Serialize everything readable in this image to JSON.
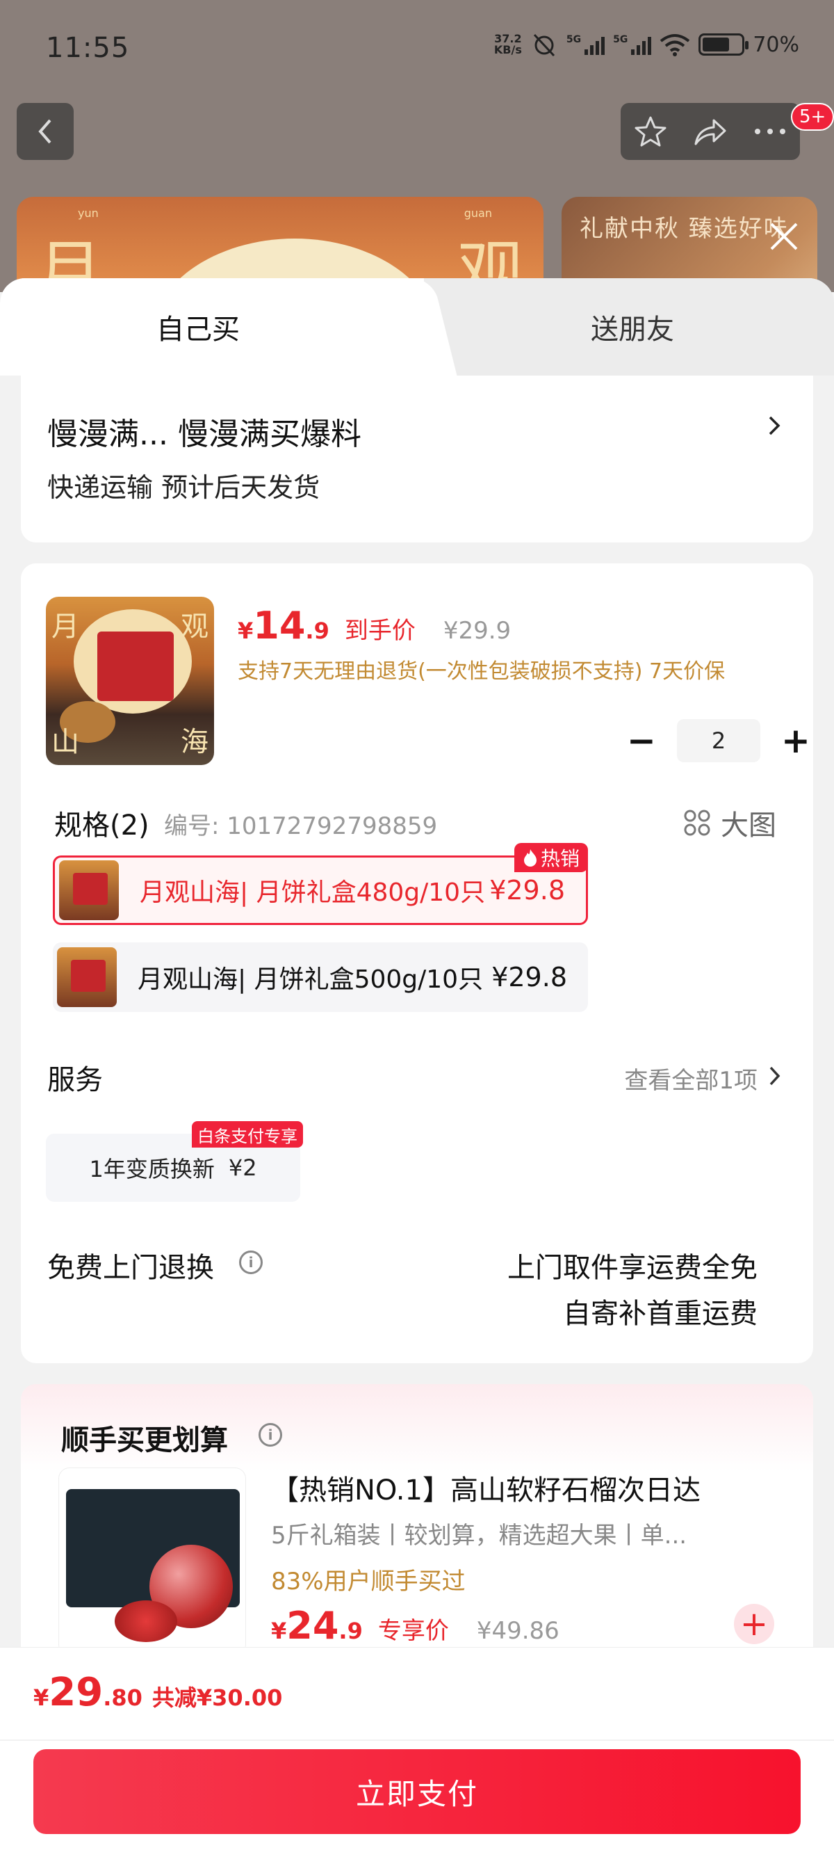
{
  "status_bar": {
    "time": "11:55",
    "net_speed_value": "37.2",
    "net_speed_unit": "KB/s",
    "signal_1": "5G",
    "signal_2": "5G",
    "battery": "70%"
  },
  "top_bar": {
    "back_icon": "chevron-left-icon",
    "favorite_icon": "star-icon",
    "share_icon": "share-icon",
    "more_icon": "more-icon",
    "message_badge": "5+"
  },
  "banner": {
    "left_chars": [
      "月",
      "观"
    ],
    "left_pinyin": [
      "yun",
      "guan"
    ],
    "right_text": "礼献中秋 臻选好味"
  },
  "tabs": [
    {
      "label": "自己买",
      "active": true
    },
    {
      "label": "送朋友",
      "active": false
    }
  ],
  "address": {
    "title": "慢漫满... 慢漫满买爆料",
    "subtitle": "快递运输 预计后天发货"
  },
  "product": {
    "image_chars": [
      "月",
      "观",
      "山",
      "海"
    ],
    "currency": "¥",
    "price_int": "14",
    "price_dec": ".9",
    "price_label": "到手价",
    "original_price": "¥29.9",
    "guarantee": "支持7天无理由退货(一次性包装破损不支持) 7天价保",
    "quantity": "2",
    "minus": "−",
    "plus": "+"
  },
  "spec": {
    "title": "规格(2)",
    "code": "编号: 10172792798859",
    "big_pic_label": "大图",
    "hot_label": "热销",
    "options": [
      {
        "name": "月观山海| 月饼礼盒480g/10只",
        "price": "¥29.8",
        "selected": true
      },
      {
        "name": "月观山海| 月饼礼盒500g/10只",
        "price": "¥29.8",
        "selected": false
      }
    ]
  },
  "service": {
    "title": "服务",
    "view_all": "查看全部1项",
    "badge": "白条支付专享",
    "chip_name": "1年变质换新",
    "chip_price": "¥2"
  },
  "returns": {
    "title": "免费上门退换",
    "line1": "上门取件享运费全免",
    "line2": "自寄补首重运费"
  },
  "recommend": {
    "title": "顺手买更划算",
    "name": "【热销NO.1】高山软籽石榴次日达",
    "desc": "5斤礼箱装丨较划算，精选超大果丨单...",
    "ratio": "83%用户顺手买过",
    "currency": "¥",
    "price_int": "24",
    "price_dec": ".9",
    "price_label": "专享价",
    "original_price": "¥49.86",
    "add": "+"
  },
  "footer": {
    "currency": "¥",
    "total_int": "29",
    "total_dec": ".80",
    "discount": "共减¥30.00",
    "pay_label": "立即支付"
  },
  "colors": {
    "accent": "#e8262c",
    "gold": "#c28a32",
    "muted": "#999999"
  }
}
